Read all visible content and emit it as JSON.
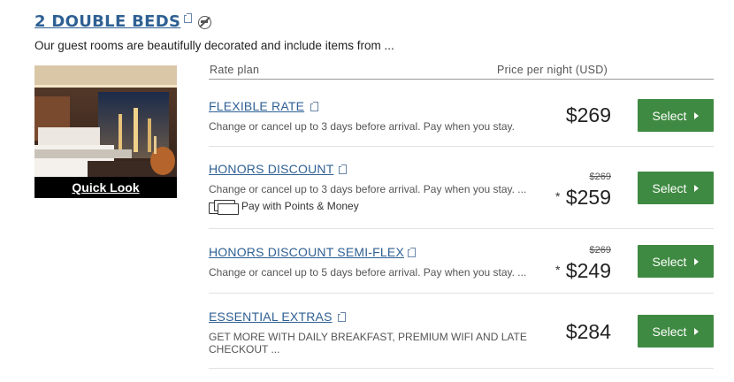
{
  "room": {
    "title": "2 DOUBLE BEDS",
    "description": "Our guest rooms are beautifully decorated and include items from ...",
    "quick_look_label": "Quick Look"
  },
  "table_header": {
    "rate_plan": "Rate plan",
    "price_per_night": "Price per night (USD)"
  },
  "rates": [
    {
      "name": "FLEXIBLE RATE",
      "description": "Change or cancel up to 3 days before arrival. Pay when you stay.",
      "price": "$269",
      "select_label": "Select"
    },
    {
      "name": "HONORS DISCOUNT",
      "description": "Change or cancel up to 3 days before arrival. Pay when you stay. ...",
      "original_price": "$269",
      "asterisk": "*",
      "price": "$259",
      "points_label": "Pay with Points & Money",
      "select_label": "Select"
    },
    {
      "name": "HONORS DISCOUNT SEMI-FLEX",
      "description": "Change or cancel up to 5 days before arrival. Pay when you stay. ...",
      "original_price": "$269",
      "asterisk": "*",
      "price": "$249",
      "select_label": "Select"
    },
    {
      "name": "ESSENTIAL EXTRAS",
      "description": "GET MORE WITH DAILY BREAKFAST, PREMIUM WIFI AND LATE CHECKOUT ...",
      "price": "$284",
      "select_label": "Select"
    }
  ],
  "colors": {
    "link": "#2f6093",
    "select_button": "#3f8a42"
  },
  "icons": [
    "external-link-icon",
    "no-smoking-icon",
    "points-money-icon",
    "chevron-right-icon"
  ]
}
